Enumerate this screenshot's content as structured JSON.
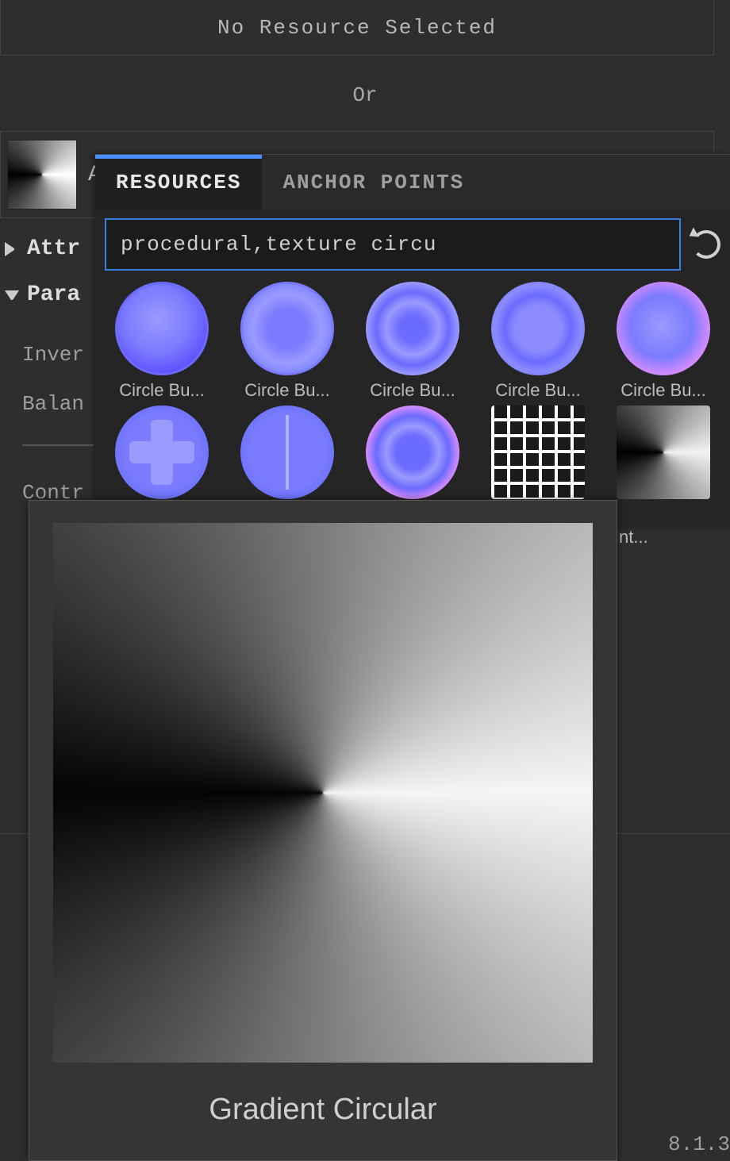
{
  "panel": {
    "no_resource": "No Resource Selected",
    "or": "Or",
    "anisotropy_title": "Anisotropy angle",
    "attributes": "Attr",
    "parameters": "Para",
    "params": {
      "invert": "Inver",
      "balance": "Balan",
      "contrast": "Contr"
    },
    "version": "8.1.3"
  },
  "popup": {
    "tabs": {
      "resources": "RESOURCES",
      "anchor": "ANCHOR POINTS"
    },
    "search_value": "procedural,texture circu",
    "thumbs": [
      {
        "label": "Circle Bu...",
        "style": "nm1"
      },
      {
        "label": "Circle Bu...",
        "style": "nm2"
      },
      {
        "label": "Circle Bu...",
        "style": "nm3"
      },
      {
        "label": "Circle Bu...",
        "style": "nm4"
      },
      {
        "label": "Circle Bu...",
        "style": "nm5"
      },
      {
        "label": "",
        "style": "nm6"
      },
      {
        "label": "",
        "style": "nm7"
      },
      {
        "label": "",
        "style": "nm8"
      },
      {
        "label": "",
        "style": "greek-pattern"
      },
      {
        "label": "",
        "style": "gradient-circ-thumb"
      }
    ],
    "gradient_partial_label": "nt..."
  },
  "tooltip": {
    "title": "Gradient Circular"
  }
}
